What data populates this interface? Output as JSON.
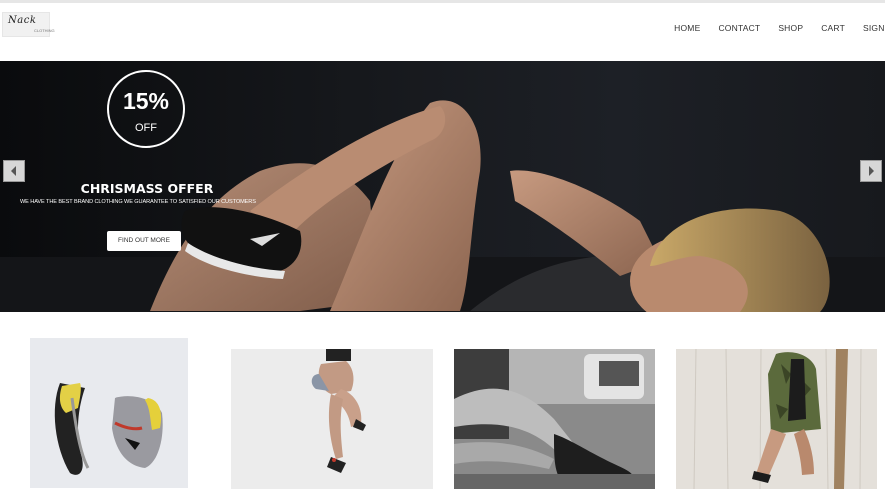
{
  "header": {
    "logo_text": "Nack",
    "logo_sub": "CLOTHING",
    "nav": [
      "HOME",
      "CONTACT",
      "SHOP",
      "CART",
      "SIGN"
    ]
  },
  "hero": {
    "discount_value": "15%",
    "discount_label": "OFF",
    "title": "CHRISMASS OFFER",
    "subtitle": "WE HAVE THE BEST BRAND CLOTHING WE GUARANTEE TO SATISFIED OUR CUSTOMERS",
    "cta": "FIND OUT MORE"
  },
  "products": [
    {
      "image": "sneakers-pair"
    },
    {
      "image": "woman-jumping"
    },
    {
      "image": "boots-legs-bw"
    },
    {
      "image": "woman-camo-jacket"
    }
  ],
  "icons": {
    "prev": "chevron-left-icon",
    "next": "chevron-right-icon"
  },
  "colors": {
    "hero_bg": "#16181c",
    "nav_text": "#333333",
    "cta_bg": "#ffffff"
  }
}
